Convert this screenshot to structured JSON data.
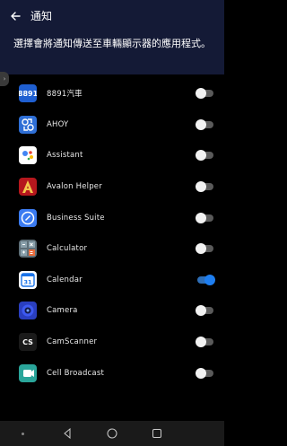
{
  "header": {
    "title": "通知"
  },
  "subtitle": "選擇會將通知傳送至車輛顯示器的應用程式。",
  "apps": [
    {
      "label": "8891汽車",
      "icon": "8891-logo-icon",
      "icon_text": "8891",
      "bg": "#1f5fd1",
      "enabled": false
    },
    {
      "label": "AHOY",
      "icon": "ahoy-logo-icon",
      "icon_text": "",
      "bg": "#2f6fd6",
      "enabled": false
    },
    {
      "label": "Assistant",
      "icon": "assistant-icon",
      "icon_text": "",
      "bg": "#ffffff",
      "enabled": false
    },
    {
      "label": "Avalon Helper",
      "icon": "avalon-helper-icon",
      "icon_text": "A",
      "bg": "#b5171d",
      "enabled": false
    },
    {
      "label": "Business Suite",
      "icon": "business-suite-icon",
      "icon_text": "",
      "bg": "#3b7bf1",
      "enabled": false
    },
    {
      "label": "Calculator",
      "icon": "calculator-icon",
      "icon_text": "",
      "bg": "#5e6f78",
      "enabled": false
    },
    {
      "label": "Calendar",
      "icon": "calendar-icon",
      "icon_text": "31",
      "bg": "#ffffff",
      "enabled": true
    },
    {
      "label": "Camera",
      "icon": "camera-icon",
      "icon_text": "",
      "bg": "#2a3fbf",
      "enabled": false
    },
    {
      "label": "CamScanner",
      "icon": "camscanner-icon",
      "icon_text": "CS",
      "bg": "#1a1a1a",
      "enabled": false
    },
    {
      "label": "Cell Broadcast",
      "icon": "cell-broadcast-icon",
      "icon_text": "",
      "bg": "#2aa59a",
      "enabled": false
    }
  ],
  "colors": {
    "appbar": "#141a36",
    "toggle_on": "#1e7ef0"
  },
  "nav": {
    "back": "nav-back-icon",
    "home": "nav-home-icon",
    "recents": "nav-recents-icon"
  }
}
